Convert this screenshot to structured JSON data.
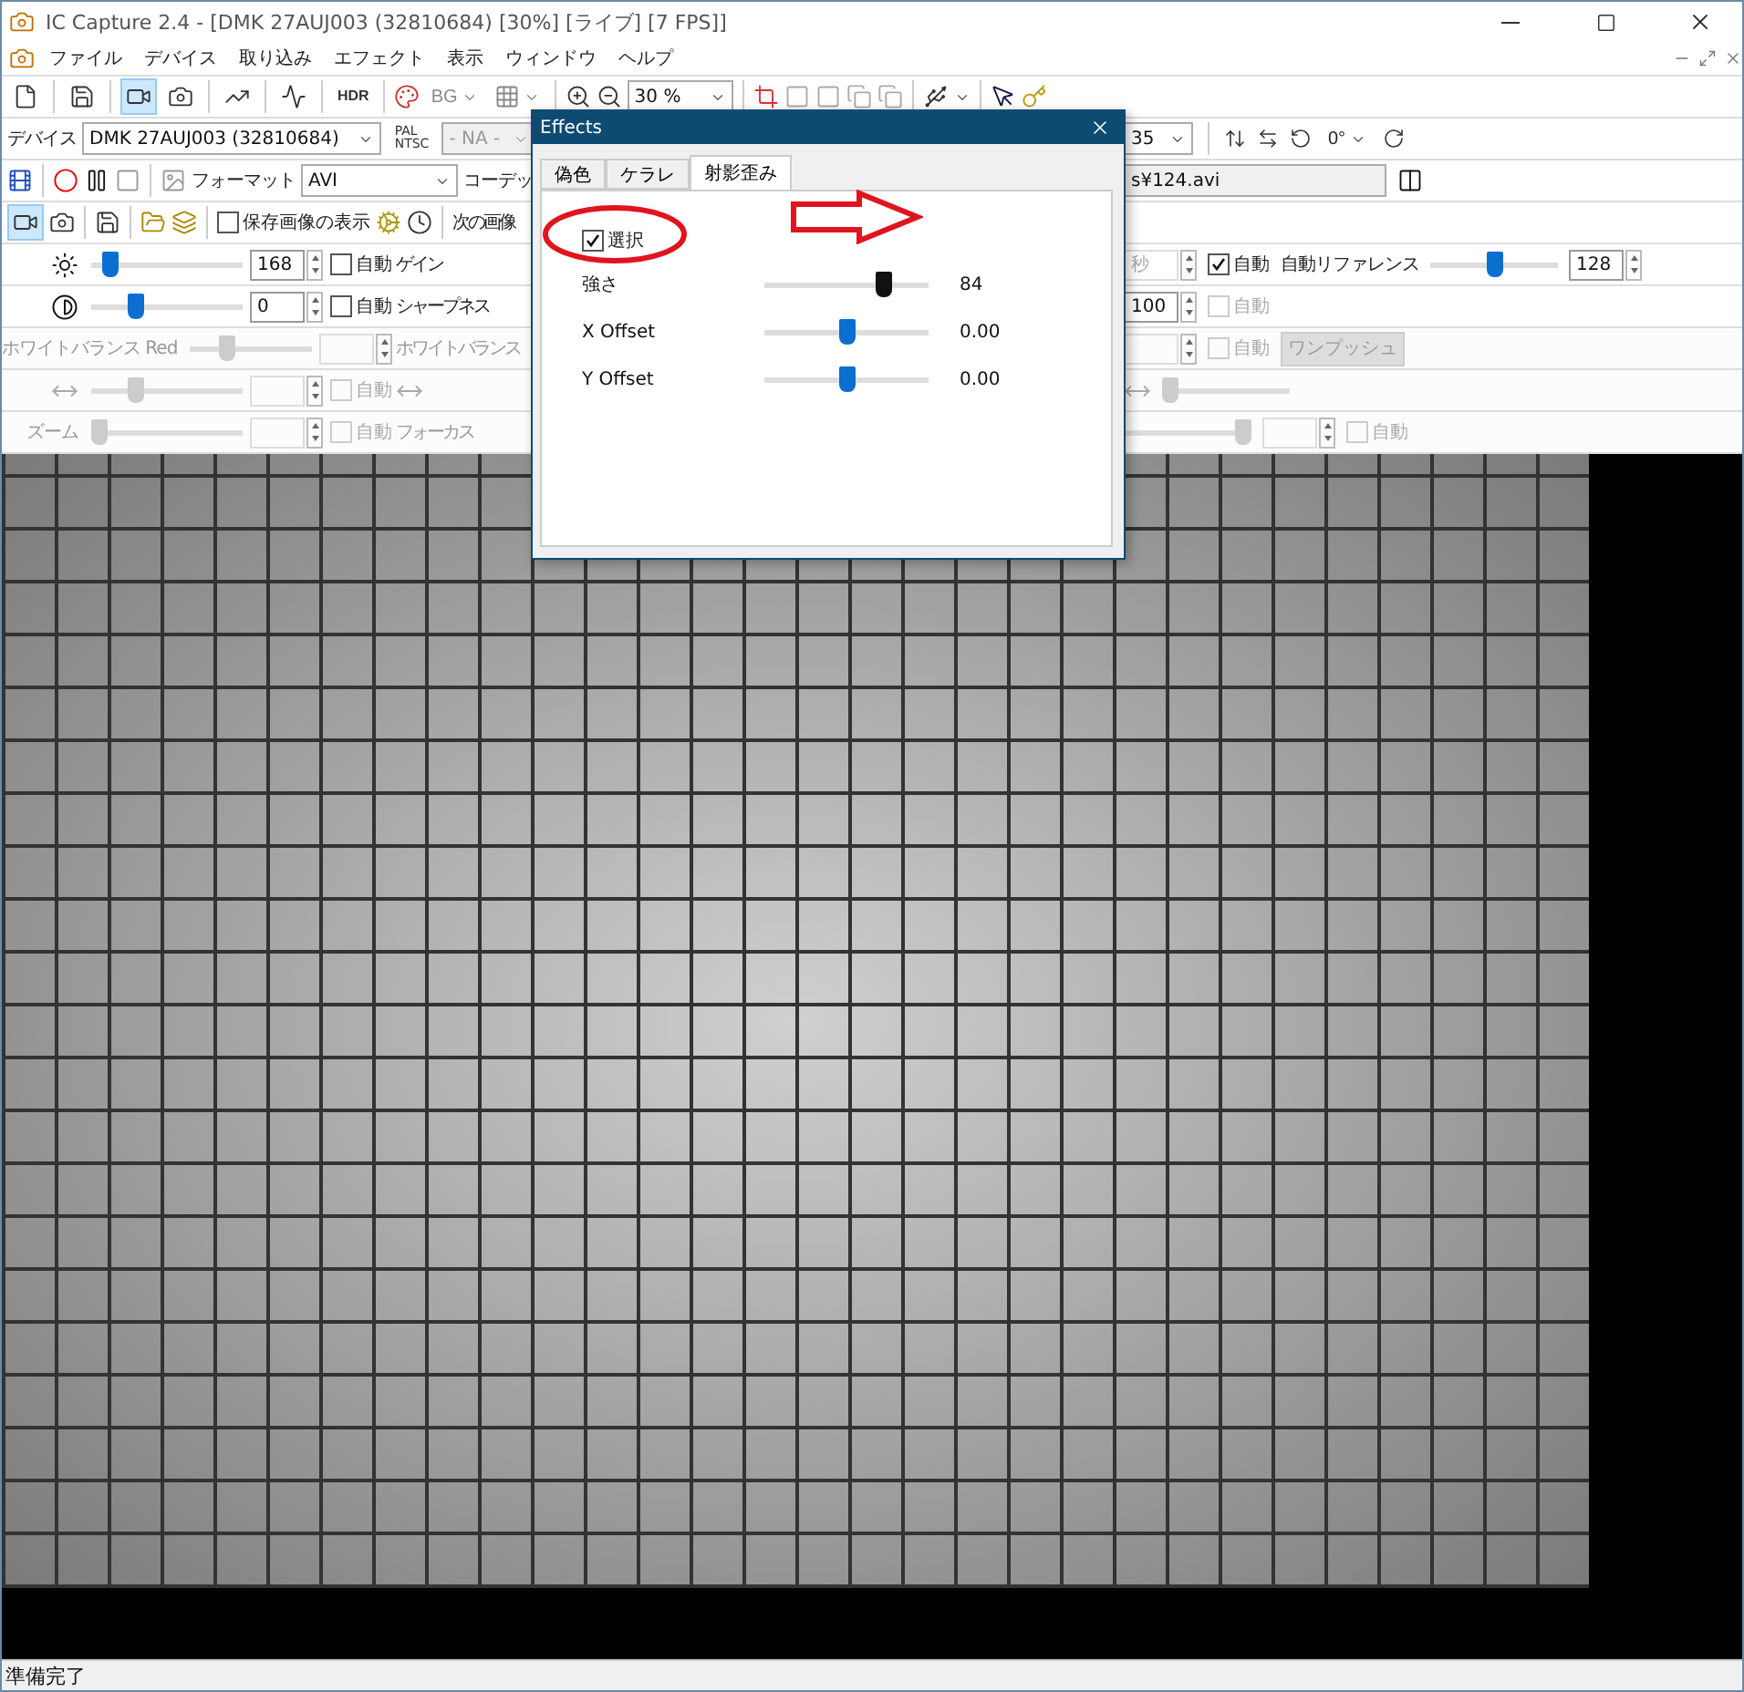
{
  "window": {
    "title": "IC Capture 2.4 - [DMK 27AUJ003 (32810684) [30%]  [ライブ]  [7 FPS]]"
  },
  "menu": [
    "ファイル",
    "デバイス",
    "取り込み",
    "エフェクト",
    "表示",
    "ウィンドウ",
    "ヘルプ"
  ],
  "toolbar": {
    "buttons": [
      {
        "selected": false
      },
      {
        "selected": false
      },
      {
        "selected": true
      },
      {
        "selected": false
      },
      {
        "selected": false
      },
      {
        "selected": false
      }
    ],
    "hdr": "HDR",
    "bg": "BG",
    "zoom": "30 %"
  },
  "device_bar": {
    "label": "デバイス",
    "device": "DMK 27AUJ003 (32810684)",
    "norm_top": "PAL",
    "norm_bottom": "NTSC",
    "norm": "- NA -",
    "rate": "35",
    "rotation": "0°"
  },
  "capture_bar": {
    "format_label": "フォーマット",
    "format": "AVI",
    "codec_label": "コーデッ",
    "file": "s¥124.avi"
  },
  "image_bar": {
    "live_selected": true,
    "show_saved": {
      "label": "保存画像の表示",
      "checked": false
    },
    "next_label": "次の画像"
  },
  "properties": [
    {
      "disabled": false,
      "left": [
        {
          "kind": "icon"
        },
        {
          "kind": "slider",
          "level": 0.08
        },
        {
          "kind": "spin",
          "value": "168"
        },
        {
          "kind": "auto",
          "label": "自動",
          "checked": false,
          "disabled": false
        }
      ],
      "mid": [
        {
          "kind": "label",
          "label": "ゲイン"
        }
      ],
      "right": [
        {
          "kind": "spin",
          "value": "秒",
          "disabled": true
        },
        {
          "kind": "auto",
          "label": "自動",
          "checked": true,
          "disabled": false
        },
        {
          "kind": "label",
          "label": "自動リファレンス"
        },
        {
          "kind": "slider",
          "level": 0.5
        },
        {
          "kind": "spin",
          "value": "128"
        }
      ]
    },
    {
      "disabled": false,
      "left": [
        {
          "kind": "icon"
        },
        {
          "kind": "slider",
          "level": 0.27
        },
        {
          "kind": "spin",
          "value": "0"
        },
        {
          "kind": "auto",
          "label": "自動",
          "checked": false,
          "disabled": false
        }
      ],
      "mid": [
        {
          "kind": "label",
          "label": "シャープネス"
        }
      ],
      "right": [
        {
          "kind": "spin",
          "value": "100"
        },
        {
          "kind": "auto",
          "label": "自動",
          "checked": false,
          "disabled": true
        }
      ]
    },
    {
      "disabled": true,
      "left": [
        {
          "kind": "label",
          "label": "ホワイトバランス Red"
        },
        {
          "kind": "slider",
          "level": 0.27
        },
        {
          "kind": "spin"
        }
      ],
      "mid": [
        {
          "kind": "label",
          "label": "ホワイトバランス"
        }
      ],
      "right": [
        {
          "kind": "spin"
        },
        {
          "kind": "auto",
          "label": "自動",
          "checked": false
        },
        {
          "kind": "button",
          "label": "ワンプッシュ"
        }
      ]
    },
    {
      "disabled": true,
      "left": [
        {
          "kind": "icon"
        },
        {
          "kind": "slider",
          "level": 0.27
        },
        {
          "kind": "spin"
        },
        {
          "kind": "auto",
          "label": "自動",
          "checked": false
        }
      ],
      "mid": [
        {
          "kind": "icon"
        }
      ],
      "right": [
        {
          "kind": "icon"
        },
        {
          "kind": "slider",
          "level": 0.0
        }
      ]
    },
    {
      "disabled": true,
      "left": [
        {
          "kind": "label",
          "label": "ズーム"
        },
        {
          "kind": "slider",
          "level": 0.0
        },
        {
          "kind": "spin"
        },
        {
          "kind": "auto",
          "label": "自動",
          "checked": false
        }
      ],
      "mid": [
        {
          "kind": "label",
          "label": "フォーカス"
        }
      ],
      "right": [
        {
          "kind": "slider",
          "level": 1.0
        },
        {
          "kind": "spin"
        },
        {
          "kind": "auto",
          "label": "自動",
          "checked": false
        }
      ]
    }
  ],
  "status_bar": {
    "text": "準備完了"
  },
  "dialog": {
    "title": "Effects",
    "tabs": [
      {
        "label": "偽色",
        "selected": false
      },
      {
        "label": "ケラレ",
        "selected": false
      },
      {
        "label": "射影歪み",
        "selected": true
      }
    ],
    "enable": {
      "label": "選択",
      "checked": true
    },
    "sliders": [
      {
        "label": "強さ",
        "level": 0.75,
        "reading": "84",
        "kind": "dark"
      },
      {
        "label": "X Offset",
        "level": 0.5,
        "reading": "0.00",
        "kind": "blue"
      },
      {
        "label": "Y Offset",
        "level": 0.5,
        "reading": "0.00",
        "kind": "blue"
      }
    ]
  }
}
